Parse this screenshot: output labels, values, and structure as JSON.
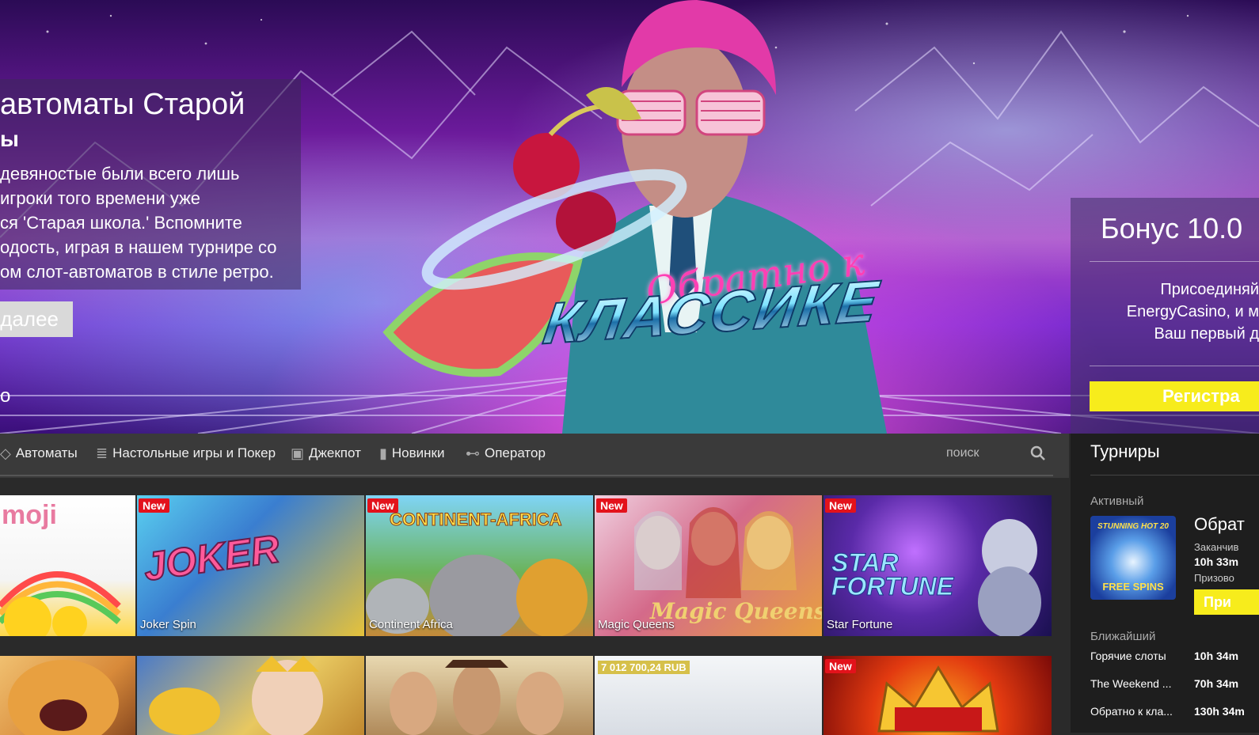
{
  "hero": {
    "title_line1": "автоматы Старой",
    "title_line2": "ы",
    "description": [
      "девяностые были всего лишь",
      "игроки того времени уже",
      "ся 'Старая школа.' Вспомните",
      "одость, играя в нашем турнире со",
      "ом слот-автоматов в стиле ретро."
    ],
    "more_button": "далее",
    "fragment": "о",
    "promo_logo_top": "Обратно к",
    "promo_logo_bottom": "КЛАССИКЕ"
  },
  "bonus": {
    "title": "Бонус 10.0",
    "lines": [
      "Присоединяй",
      "EnergyCasino, и м",
      "Ваш первый д"
    ],
    "register_button": "Регистра"
  },
  "nav": {
    "items": [
      {
        "label": "Автоматы",
        "icon": "diamond-icon"
      },
      {
        "label": "Настольные игры и Покер",
        "icon": "chips-icon"
      },
      {
        "label": "Джекпот",
        "icon": "cash-icon"
      },
      {
        "label": "Новинки",
        "icon": "bookmark-icon"
      },
      {
        "label": "Оператор",
        "icon": "gamepad-icon"
      }
    ],
    "search_placeholder": "поиск"
  },
  "games_row1": [
    {
      "label": "",
      "badge": "",
      "art": "moji"
    },
    {
      "label": "Joker Spin",
      "badge": "New",
      "art": "JOKER"
    },
    {
      "label": "Continent Africa",
      "badge": "New",
      "art": "CONTINENT-AFRICA"
    },
    {
      "label": "Magic Queens",
      "badge": "New",
      "art": "Magic Queens"
    },
    {
      "label": "Star Fortune",
      "badge": "New",
      "art": "STAR FORTUNE"
    }
  ],
  "games_row2": [
    {
      "badge": ""
    },
    {
      "badge": ""
    },
    {
      "badge": ""
    },
    {
      "badge": "",
      "jackpot": "7 012 700,24 RUB"
    },
    {
      "badge": "New"
    }
  ],
  "tournaments": {
    "title": "Турниры",
    "active_label": "Активный",
    "active": {
      "name": "Обрат",
      "ends_label": "Заканчив",
      "time": "10h 33m",
      "prize_label": "Призово",
      "join_button": "При",
      "thumb_text_top": "STUNNING HOT 20",
      "thumb_text_bottom": "FREE SPINS"
    },
    "nearest_label": "Ближайший",
    "nearest": [
      {
        "name": "Горячие слоты",
        "time": "10h 34m"
      },
      {
        "name": "The Weekend ...",
        "time": "70h 34m"
      },
      {
        "name": "Обратно к кла...",
        "time": "130h 34m"
      }
    ]
  },
  "colors": {
    "accent_yellow": "#f7ec1c",
    "badge_red": "#e3121b",
    "nav_bg": "#3a3a3a",
    "sidebar_bg": "#1e1e1e"
  }
}
